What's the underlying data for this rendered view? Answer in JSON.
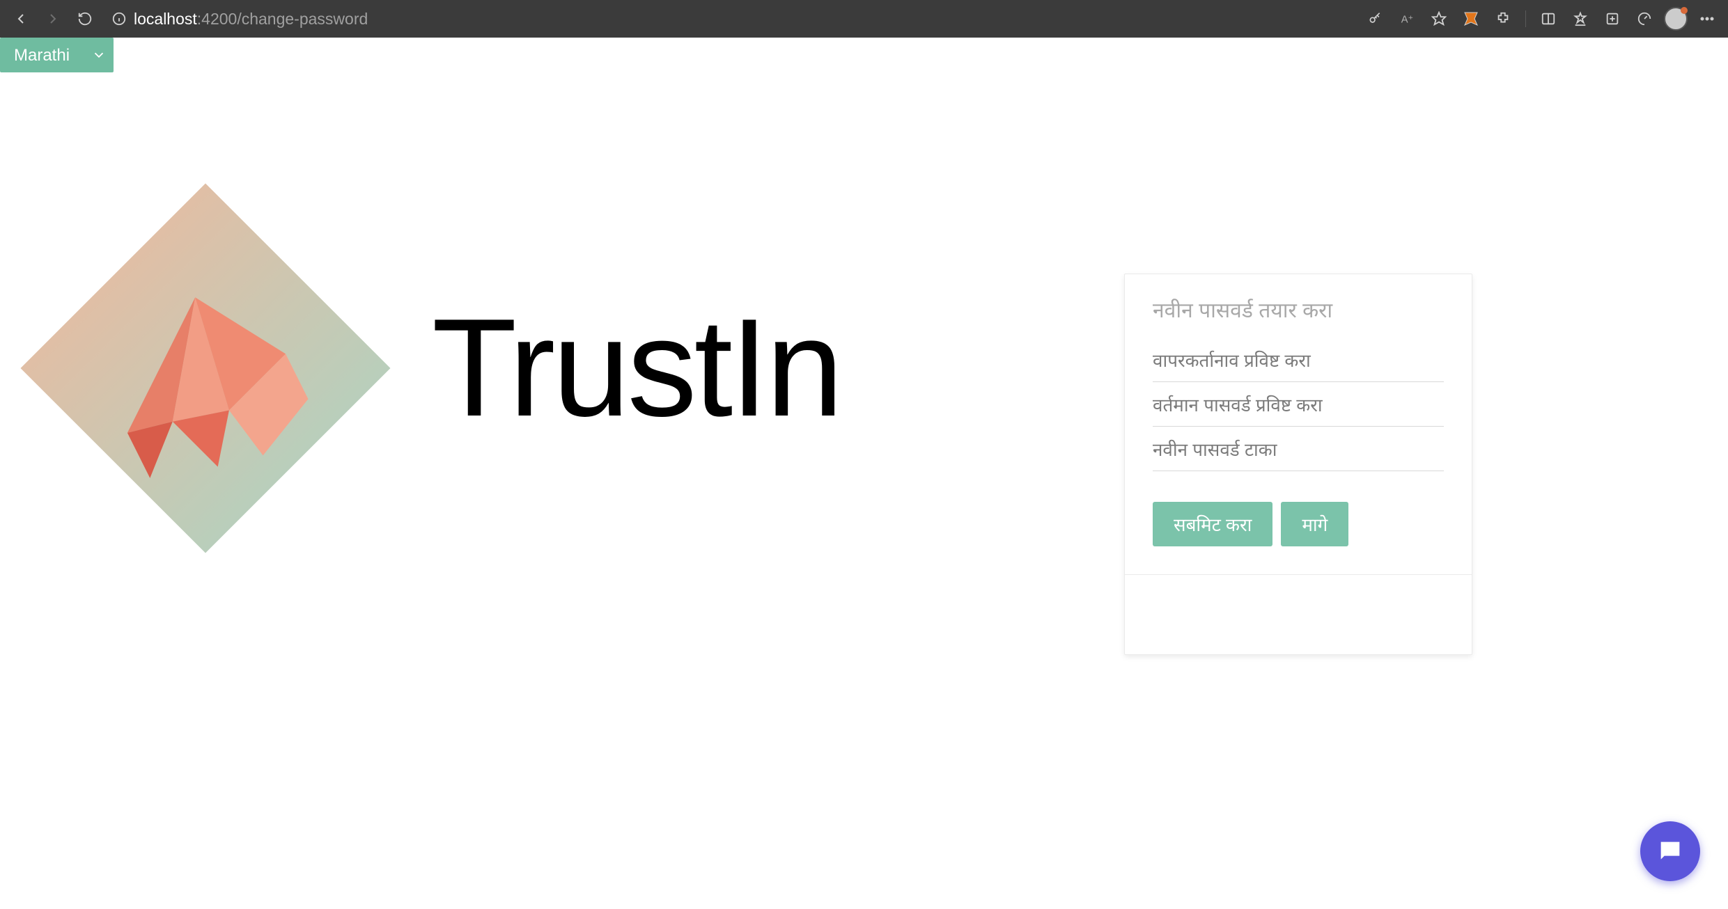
{
  "browser": {
    "url_host": "localhost",
    "url_rest": ":4200/change-password"
  },
  "language_selector": {
    "selected": "Marathi"
  },
  "brand": {
    "name": "TrustIn"
  },
  "form": {
    "title": "नवीन पासवर्ड तयार करा",
    "username_placeholder": "वापरकर्तानाव प्रविष्ट करा",
    "current_password_placeholder": "वर्तमान पासवर्ड प्रविष्ट करा",
    "new_password_placeholder": "नवीन पासवर्ड टाका",
    "submit_label": "सबमिट करा",
    "back_label": "मागे"
  }
}
